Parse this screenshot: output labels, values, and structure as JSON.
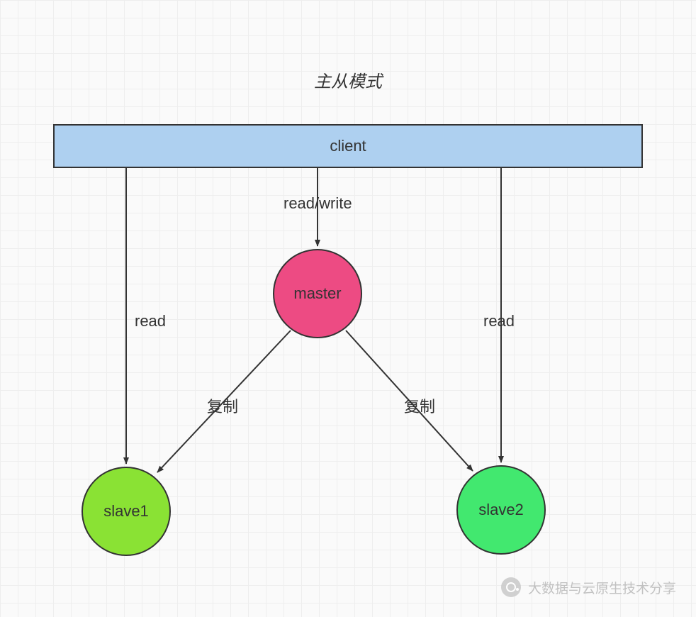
{
  "title": "主从模式",
  "nodes": {
    "client": {
      "label": "client",
      "color": "#aed0f0"
    },
    "master": {
      "label": "master",
      "color": "#ed4b83"
    },
    "slave1": {
      "label": "slave1",
      "color": "#8ae234"
    },
    "slave2": {
      "label": "slave2",
      "color": "#42e86f"
    }
  },
  "edges": {
    "client_master": {
      "label": "read/write"
    },
    "client_slave1": {
      "label": "read"
    },
    "client_slave2": {
      "label": "read"
    },
    "master_slave1": {
      "label": "复制"
    },
    "master_slave2": {
      "label": "复制"
    }
  },
  "watermark": {
    "text": "大数据与云原生技术分享"
  }
}
